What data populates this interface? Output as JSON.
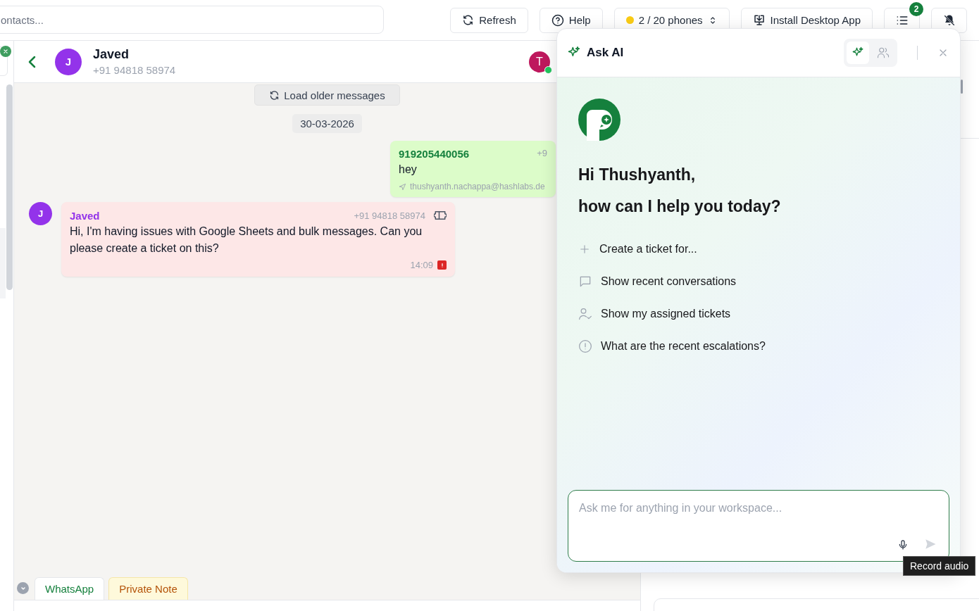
{
  "search": {
    "placeholder": "ontacts..."
  },
  "toolbar": [
    {
      "kind": "refresh",
      "label": "Refresh"
    },
    {
      "kind": "help",
      "label": "Help"
    },
    {
      "kind": "phones",
      "label": "2 / 20 phones"
    },
    {
      "kind": "install",
      "label": "Install Desktop App"
    }
  ],
  "task_badge": "2",
  "chat_header": {
    "avatar": "J",
    "name": "Javed",
    "phone": "+91 94818 58974",
    "agent_avatar": "T",
    "agent_online": true
  },
  "load_older": "Load older messages",
  "date": "30-03-2026",
  "messages": [
    {
      "kind": "outgoing",
      "sender": "919205440056",
      "phone": "+9",
      "text": "hey",
      "footer": "thushyanth.nachappa@hashlabs.de"
    },
    {
      "kind": "incoming",
      "avatar": "J",
      "sender": "Javed",
      "phone": "+91 94818 58974",
      "text": "Hi, I'm having issues with Google Sheets and bulk messages. Can you please create a ticket on this?",
      "time": "14:09",
      "flagged": true
    }
  ],
  "composer_tabs": [
    {
      "label": "WhatsApp",
      "selected": true
    },
    {
      "label": "Private Note",
      "selected": false
    }
  ],
  "ask_ai": {
    "title": "Ask AI",
    "modes": [
      {
        "kind": "ai",
        "selected": true
      },
      {
        "kind": "team",
        "selected": false
      }
    ],
    "greeting": [
      "Hi Thushyanth,",
      "how can I help you today?"
    ],
    "suggestions": [
      {
        "kind": "create",
        "label": "Create a ticket for..."
      },
      {
        "kind": "chat",
        "label": "Show recent conversations"
      },
      {
        "kind": "assigned",
        "label": "Show my assigned tickets"
      },
      {
        "kind": "alert",
        "label": "What are the recent escalations?"
      }
    ],
    "input": {
      "placeholder": "Ask me for anything in your workspace..."
    },
    "tooltip": "Record audio"
  }
}
